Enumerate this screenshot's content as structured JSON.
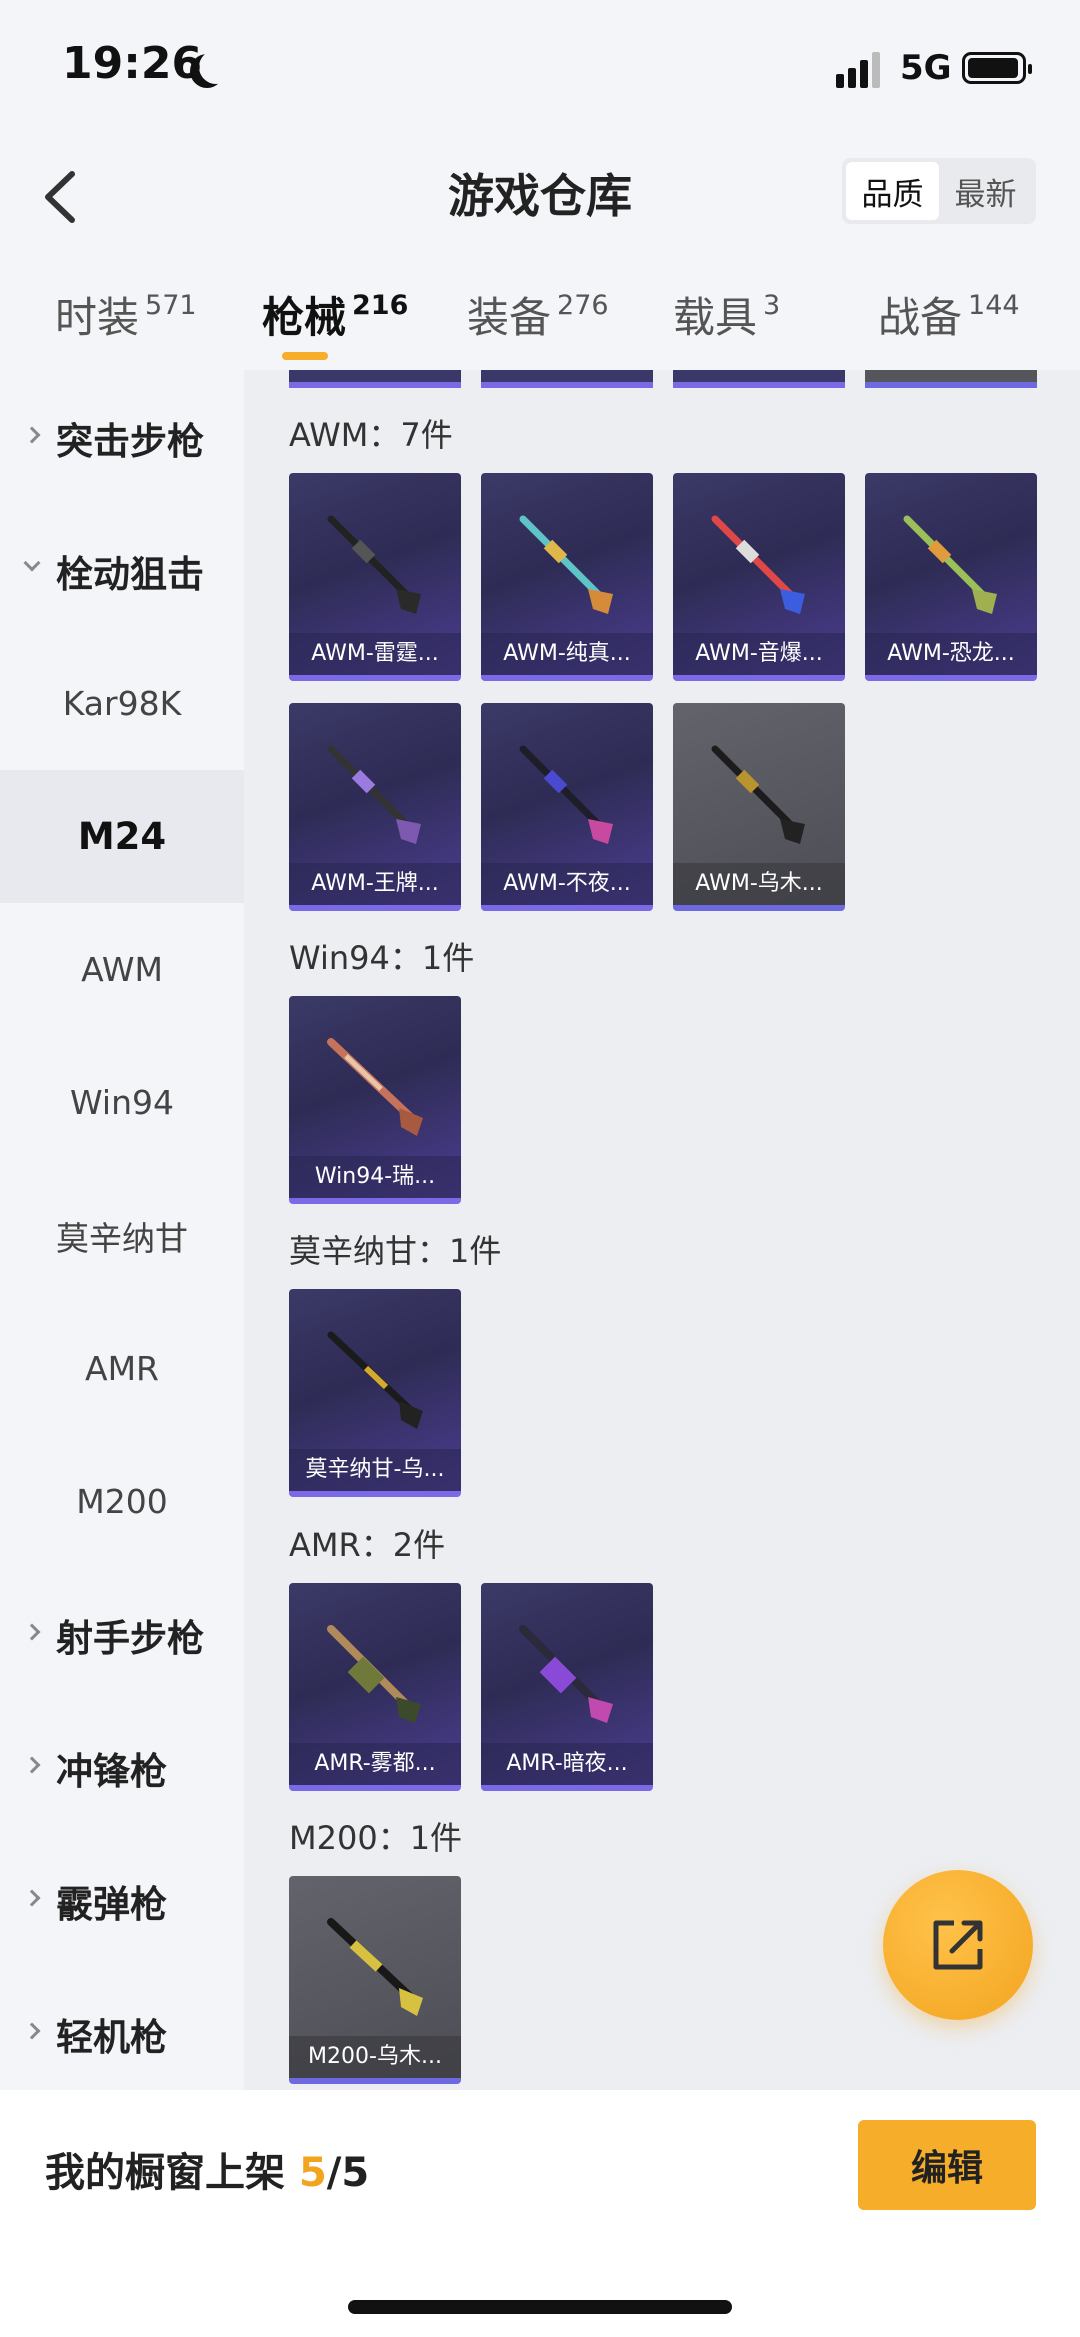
{
  "status_bar": {
    "time": "19:26",
    "network": "5G"
  },
  "header": {
    "title": "游戏仓库",
    "sort_options": [
      "品质",
      "最新"
    ]
  },
  "tabs": [
    {
      "label": "时装",
      "count": "571"
    },
    {
      "label": "枪械",
      "count": "216"
    },
    {
      "label": "装备",
      "count": "276"
    },
    {
      "label": "载具",
      "count": "3"
    },
    {
      "label": "战备",
      "count": "144"
    }
  ],
  "sidebar": [
    {
      "label": "突击步枪"
    },
    {
      "label": "栓动狙击"
    },
    {
      "label": "Kar98K"
    },
    {
      "label": "M24"
    },
    {
      "label": "AWM"
    },
    {
      "label": "Win94"
    },
    {
      "label": "莫辛纳甘"
    },
    {
      "label": "AMR"
    },
    {
      "label": "M200"
    },
    {
      "label": "射手步枪"
    },
    {
      "label": "冲锋枪"
    },
    {
      "label": "霰弹枪"
    },
    {
      "label": "轻机枪"
    }
  ],
  "sections": [
    {
      "title": "AWM：7件",
      "items": [
        "AWM-雷霆...",
        "AWM-纯真...",
        "AWM-音爆...",
        "AWM-恐龙...",
        "AWM-王牌...",
        "AWM-不夜...",
        "AWM-乌木..."
      ]
    },
    {
      "title": "Win94：1件",
      "items": [
        "Win94-瑞..."
      ]
    },
    {
      "title": "莫辛纳甘：1件",
      "items": [
        "莫辛纳甘-乌..."
      ]
    },
    {
      "title": "AMR：2件",
      "items": [
        "AMR-雾都...",
        "AMR-暗夜..."
      ]
    },
    {
      "title": "M200：1件",
      "items": [
        "M200-乌木..."
      ]
    }
  ],
  "bottom": {
    "shop_label": "我的橱窗上架",
    "shop_count": "5",
    "shop_total": "/5",
    "edit_label": "编辑"
  }
}
